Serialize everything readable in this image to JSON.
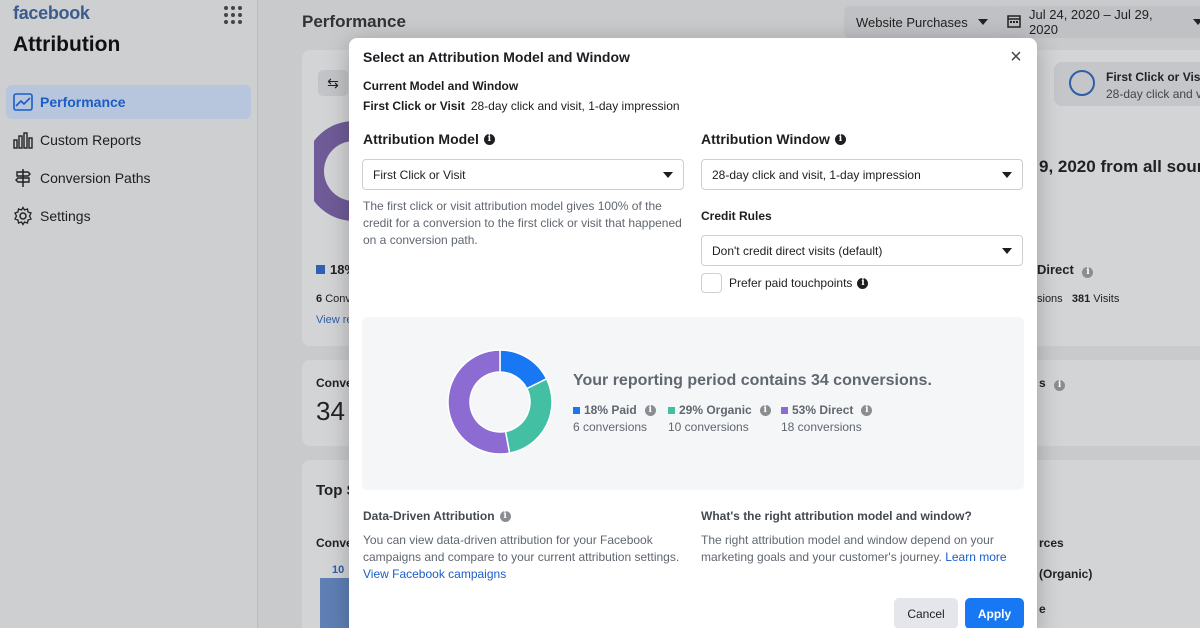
{
  "sidebar": {
    "brand": "facebook",
    "app_title": "Attribution",
    "items": [
      {
        "label": "Performance",
        "icon": "line-chart-icon"
      },
      {
        "label": "Custom Reports",
        "icon": "bar-chart-icon"
      },
      {
        "label": "Conversion Paths",
        "icon": "signpost-icon"
      },
      {
        "label": "Settings",
        "icon": "gear-icon"
      }
    ]
  },
  "header": {
    "title": "Performance",
    "metric_select": "Website Purchases",
    "date_range": "Jul 24, 2020 – Jul 29, 2020"
  },
  "background": {
    "right_card_title": "First Click or Visi",
    "right_card_sub": "28-day click and v",
    "summary_text": "9, 2020 from all sour",
    "pct_paid": "18%",
    "direct_label": "Direct",
    "conv_short": "Conv",
    "conv_count_left": "6",
    "view_link": "View re",
    "sessions_text": "sions",
    "visits_count": "381",
    "visits_label": "Visits",
    "conv_card_label": "Conve",
    "conv_card_value": "34",
    "top_label": "Top S",
    "conv_label2": "Conve",
    "bar_value": "10",
    "sources_label": "rces",
    "organic_label": "(Organic)",
    "letter_e": "e",
    "letter_s": "s"
  },
  "modal": {
    "title": "Select an Attribution Model and Window",
    "current_heading": "Current Model and Window",
    "current_model": "First Click or Visit",
    "current_window": "28-day click and visit, 1-day impression",
    "model_label": "Attribution Model",
    "model_value": "First Click or Visit",
    "model_description": "The first click or visit attribution model gives 100% of the credit for a conversion to the first click or visit that happened on a conversion path.",
    "window_label": "Attribution Window",
    "window_value": "28-day click and visit, 1-day impression",
    "credit_rules_label": "Credit Rules",
    "credit_rules_value": "Don't credit direct visits (default)",
    "prefer_paid_label": "Prefer paid touchpoints",
    "chart_heading": "Your reporting period contains 34 conversions.",
    "legend": [
      {
        "label": "18% Paid",
        "count": "6 conversions",
        "color": "#1877f2"
      },
      {
        "label": "29% Organic",
        "count": "10 conversions",
        "color": "#43c0a4"
      },
      {
        "label": "53% Direct",
        "count": "18 conversions",
        "color": "#8c6cd2"
      }
    ],
    "data_driven_label": "Data-Driven Attribution",
    "data_driven_text": "You can view data-driven attribution for your Facebook campaigns and compare to your current attribution settings.",
    "data_driven_link": "View Facebook campaigns",
    "right_model_label": "What's the right attribution model and window?",
    "right_model_text": "The right attribution model and window depend on your marketing goals and your customer's journey.",
    "learn_more": "Learn more",
    "cancel": "Cancel",
    "apply": "Apply"
  },
  "chart_data": {
    "type": "pie",
    "categories": [
      "Paid",
      "Organic",
      "Direct"
    ],
    "values": [
      6,
      10,
      18
    ],
    "percents": [
      18,
      29,
      53
    ],
    "colors": [
      "#1877f2",
      "#43c0a4",
      "#8c6cd2"
    ]
  }
}
